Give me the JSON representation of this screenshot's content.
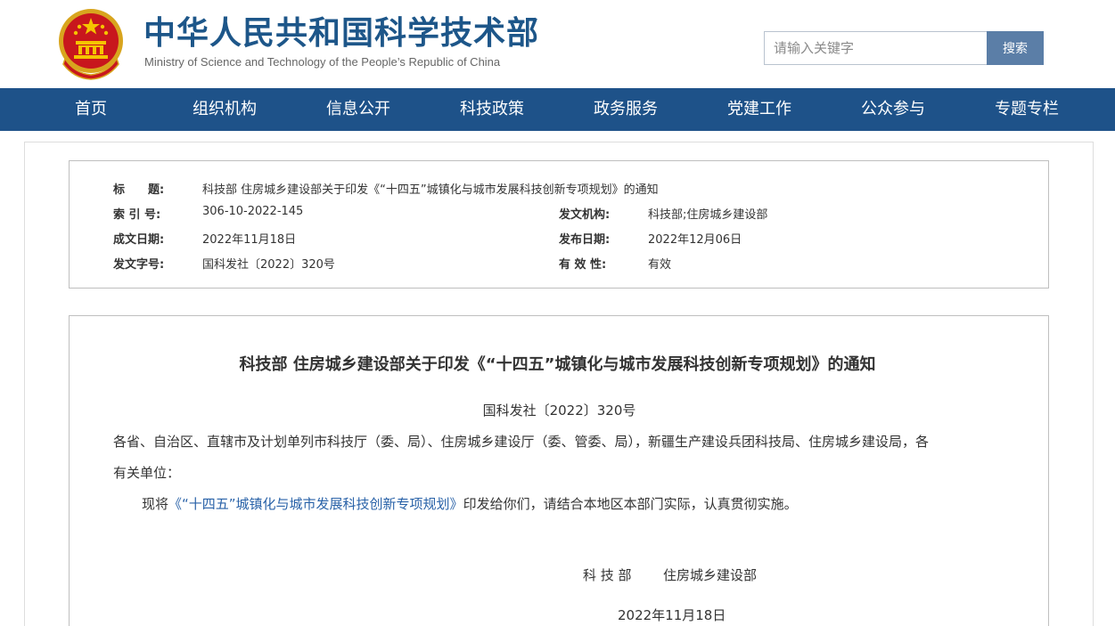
{
  "header": {
    "title_cn": "中华人民共和国科学技术部",
    "title_en": "Ministry of Science and Technology of the People’s Republic of China",
    "search_placeholder": "请输入关键字",
    "search_button": "搜索"
  },
  "nav": {
    "items": [
      "首页",
      "组织机构",
      "信息公开",
      "科技政策",
      "政务服务",
      "党建工作",
      "公众参与",
      "专题专栏"
    ]
  },
  "meta": {
    "title_label": "标　　题:",
    "title_value": "科技部 住房城乡建设部关于印发《“十四五”城镇化与城市发展科技创新专项规划》的通知",
    "index_label": "索 引 号:",
    "index_value": "306-10-2022-145",
    "issuer_label": "发文机构:",
    "issuer_value": "科技部;住房城乡建设部",
    "written_date_label": "成文日期:",
    "written_date_value": "2022年11月18日",
    "publish_date_label": "发布日期:",
    "publish_date_value": "2022年12月06日",
    "doc_no_label": "发文字号:",
    "doc_no_value": "国科发社〔2022〕320号",
    "validity_label": "有 效 性:",
    "validity_value": "有效"
  },
  "article": {
    "title": "科技部 住房城乡建设部关于印发《“十四五”城镇化与城市发展科技创新专项规划》的通知",
    "doc_number": "国科发社〔2022〕320号",
    "address_line1": "各省、自治区、直辖市及计划单列市科技厅（委、局）、住房城乡建设厅（委、管委、局），新疆生产建设兵团科技局、住房城乡建设局，各",
    "address_line2": "有关单位：",
    "body_prefix": "现将",
    "body_link": "《“十四五”城镇化与城市发展科技创新专项规划》",
    "body_suffix": "印发给你们，请结合本地区本部门实际，认真贯彻实施。",
    "signer_1": "科 技 部",
    "signer_2": "住房城乡建设部",
    "sign_date": "2022年11月18日"
  },
  "colors": {
    "brand_blue": "#1d5689",
    "nav_bg": "#1e5289",
    "search_button_bg": "#5b7ea7",
    "link": "#2962a8"
  }
}
